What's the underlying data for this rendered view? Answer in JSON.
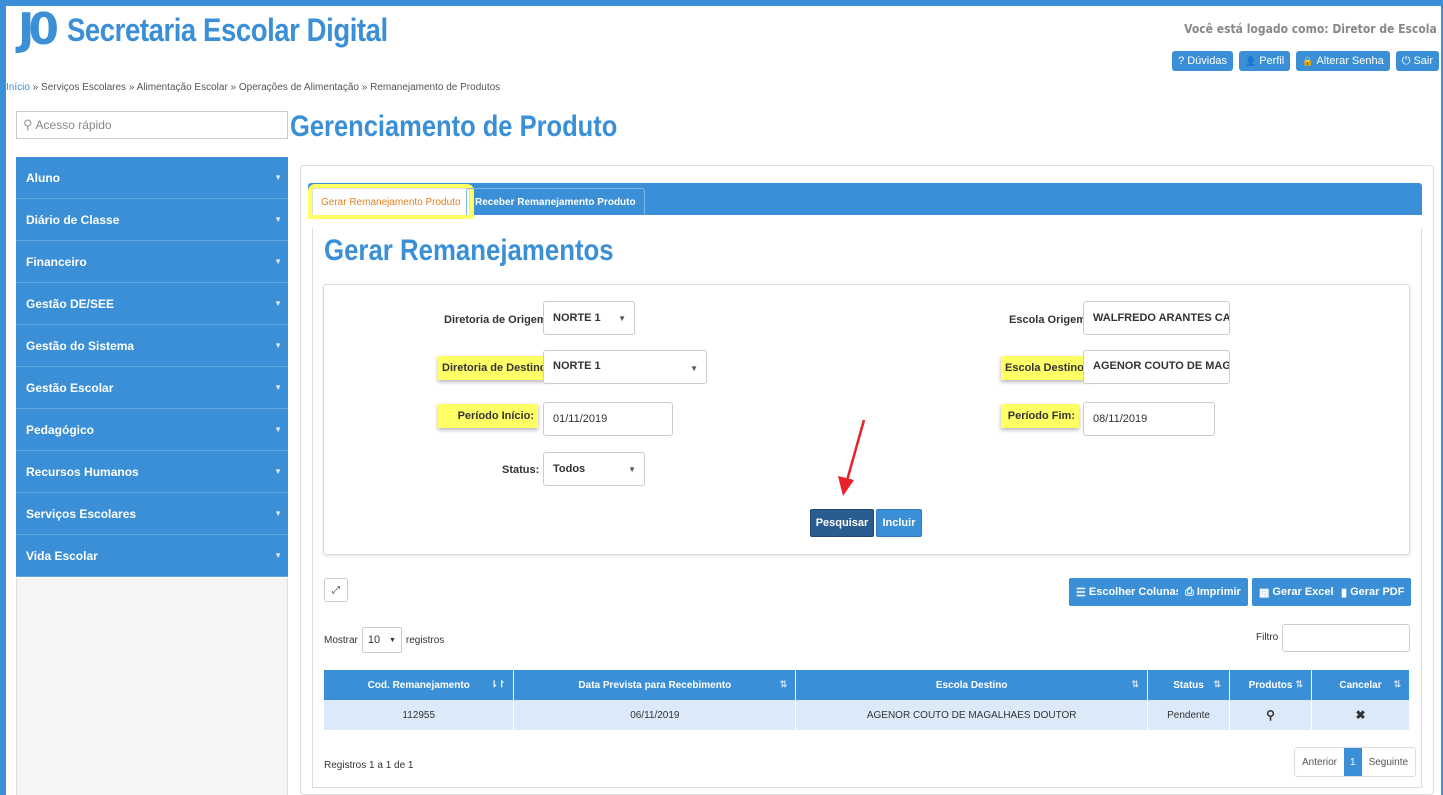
{
  "app": {
    "logo_mark": "J0",
    "title": "Secretaria Escolar Digital",
    "logged_as": "Você está logado como: Diretor de Escola",
    "top_buttons": [
      {
        "icon": "question-icon",
        "glyph": "?",
        "label": "Dúvidas"
      },
      {
        "icon": "user-icon",
        "glyph": "👤",
        "label": "Perfil"
      },
      {
        "icon": "lock-icon",
        "glyph": "🔒",
        "label": "Alterar Senha"
      },
      {
        "icon": "power-icon",
        "glyph": "⏻",
        "label": "Sair"
      }
    ]
  },
  "breadcrumb": {
    "home": "Início",
    "rest": " » Serviços Escolares » Alimentação Escolar » Operações de Alimentação » Remanejamento de Produtos"
  },
  "search": {
    "placeholder": "Acesso rápido"
  },
  "sidebar": {
    "items": [
      {
        "label": "Aluno"
      },
      {
        "label": "Diário de Classe"
      },
      {
        "label": "Financeiro"
      },
      {
        "label": "Gestão DE/SEE"
      },
      {
        "label": "Gestão do Sistema"
      },
      {
        "label": "Gestão Escolar"
      },
      {
        "label": "Pedagógico"
      },
      {
        "label": "Recursos Humanos"
      },
      {
        "label": "Serviços Escolares"
      },
      {
        "label": "Vida Escolar"
      }
    ]
  },
  "main": {
    "title": "Gerenciamento de Produto",
    "tabs": [
      {
        "label": "Gerar Remanejamento Produto",
        "active": true
      },
      {
        "label": "Receber Remanejamento Produto",
        "active": false
      }
    ],
    "section_title": "Gerar Remanejamentos"
  },
  "form": {
    "diretoria_origem": {
      "label": "Diretoria de Origem:",
      "value": "NORTE 1"
    },
    "escola_origem": {
      "label": "Escola Origem:",
      "value": "WALFREDO ARANTES CALI"
    },
    "diretoria_destino": {
      "label": "Diretoria de Destino:",
      "value": "NORTE 1"
    },
    "escola_destino": {
      "label": "Escola Destino:",
      "value": "AGENOR COUTO DE MAGA"
    },
    "periodo_inicio": {
      "label": "Período Início:",
      "value": "01/11/2019"
    },
    "periodo_fim": {
      "label": "Período Fim:",
      "value": "08/11/2019"
    },
    "status": {
      "label": "Status:",
      "value": "Todos"
    },
    "search_button": "Pesquisar",
    "include_button": "Incluir"
  },
  "toolbar": {
    "expand_glyph": "⤢",
    "choose_columns": "Escolher Colunas",
    "print": "Imprimir",
    "excel": "Gerar Excel",
    "pdf": "Gerar PDF"
  },
  "list_controls": {
    "show_label": "Mostrar",
    "page_size": "10",
    "records_label": "registros",
    "filter_label": "Filtro"
  },
  "table": {
    "headers": [
      "Cod. Remanejamento",
      "Data Prevista para Recebimento",
      "Escola Destino",
      "Status",
      "Produtos",
      "Cancelar"
    ],
    "rows": [
      {
        "cod": "112955",
        "data": "06/11/2019",
        "escola": "AGENOR COUTO DE MAGALHAES DOUTOR",
        "status": "Pendente",
        "produtos_icon": "search-icon",
        "cancelar_icon": "close-icon"
      }
    ]
  },
  "footer": {
    "records_info": "Registros 1 a 1 de 1",
    "prev": "Anterior",
    "page": "1",
    "next": "Seguinte"
  }
}
